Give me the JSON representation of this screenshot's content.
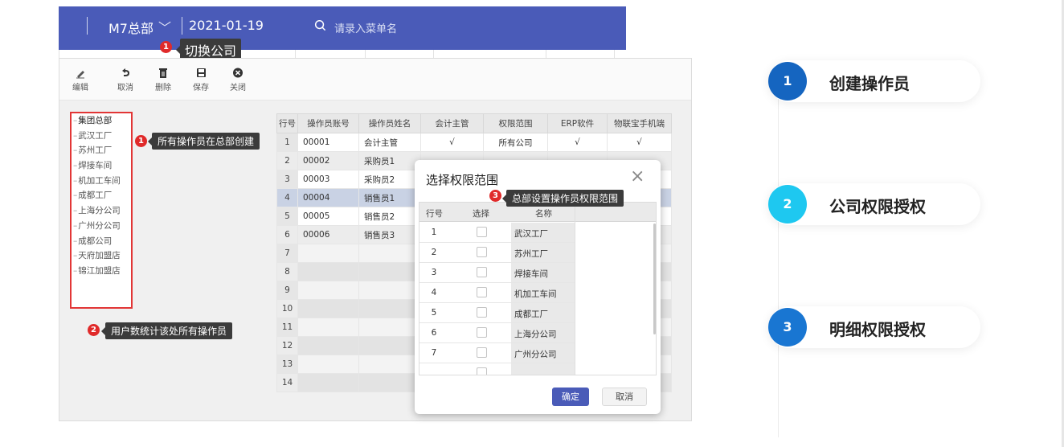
{
  "topbar": {
    "company": "M7总部",
    "date": "2021-01-19",
    "search_placeholder": "请录入菜单名",
    "tip_number": "1",
    "tip_text": "切换公司"
  },
  "toolbar": {
    "items": [
      {
        "label": "编辑",
        "icon": "pencil-icon"
      },
      {
        "label": "取消",
        "icon": "undo-icon"
      },
      {
        "label": "删除",
        "icon": "trash-icon"
      },
      {
        "label": "保存",
        "icon": "save-icon"
      },
      {
        "label": "关闭",
        "icon": "close-circle-icon"
      }
    ]
  },
  "tree": {
    "items": [
      "集团总部",
      "武汉工厂",
      "苏州工厂",
      "焊接车间",
      "机加工车间",
      "成都工厂",
      "上海分公司",
      "广州分公司",
      "成都公司",
      "天府加盟店",
      "锦江加盟店"
    ]
  },
  "annotations": {
    "a1_number": "1",
    "a1_text": "所有操作员在总部创建",
    "a2_number": "2",
    "a2_text": "用户数统计该处所有操作员",
    "a3_number": "3",
    "a3_text": "总部设置操作员权限范围"
  },
  "grid": {
    "headers": [
      "行号",
      "操作员账号",
      "操作员姓名",
      "会计主管",
      "权限范围",
      "ERP软件",
      "物联宝手机端"
    ],
    "rows": [
      {
        "no": "1",
        "account": "00001",
        "name": "会计主管",
        "acct": "√",
        "scope": "所有公司",
        "erp": "√",
        "mobile": "√"
      },
      {
        "no": "2",
        "account": "00002",
        "name": "采购员1",
        "acct": "",
        "scope": "",
        "erp": "",
        "mobile": ""
      },
      {
        "no": "3",
        "account": "00003",
        "name": "采购员2",
        "acct": "",
        "scope": "",
        "erp": "",
        "mobile": ""
      },
      {
        "no": "4",
        "account": "00004",
        "name": "销售员1",
        "acct": "",
        "scope": "",
        "erp": "",
        "mobile": ""
      },
      {
        "no": "5",
        "account": "00005",
        "name": "销售员2",
        "acct": "",
        "scope": "",
        "erp": "",
        "mobile": ""
      },
      {
        "no": "6",
        "account": "00006",
        "name": "销售员3",
        "acct": "",
        "scope": "",
        "erp": "",
        "mobile": ""
      }
    ],
    "empty_rows": [
      "7",
      "8",
      "9",
      "10",
      "11",
      "12",
      "13",
      "14"
    ]
  },
  "modal": {
    "title": "选择权限范围",
    "close": "×",
    "headers": [
      "行号",
      "选择",
      "名称"
    ],
    "rows": [
      {
        "no": "1",
        "name": "武汉工厂"
      },
      {
        "no": "2",
        "name": "苏州工厂"
      },
      {
        "no": "3",
        "name": "焊接车间"
      },
      {
        "no": "4",
        "name": "机加工车间"
      },
      {
        "no": "5",
        "name": "成都工厂"
      },
      {
        "no": "6",
        "name": "上海分公司"
      },
      {
        "no": "7",
        "name": "广州分公司"
      }
    ],
    "ok": "确定",
    "cancel": "取消"
  },
  "steps": [
    {
      "number": "1",
      "label": "创建操作员",
      "color": "#1565c0"
    },
    {
      "number": "2",
      "label": "公司权限授权",
      "color": "#1ec8f0"
    },
    {
      "number": "3",
      "label": "明细权限授权",
      "color": "#1976d2"
    }
  ]
}
